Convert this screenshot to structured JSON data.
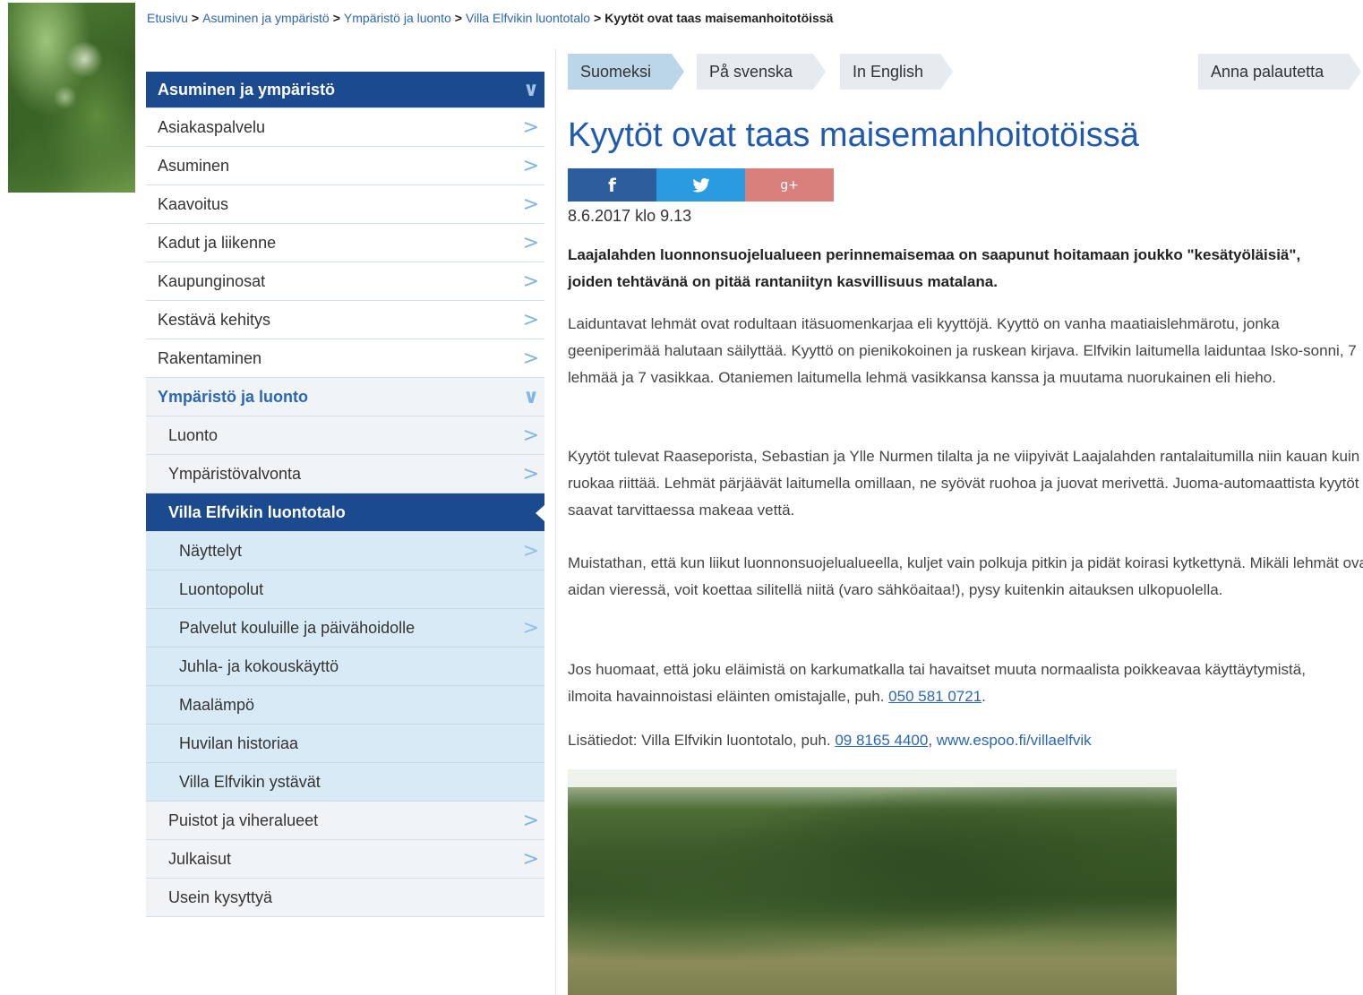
{
  "breadcrumb": {
    "items": [
      "Etusivu",
      "Asuminen ja ympäristö",
      "Ympäristö ja luonto",
      "Villa Elfvikin luontotalo"
    ],
    "separator": ">",
    "current": "Kyytöt ovat taas maisemanhoitotöissä"
  },
  "sidebar": {
    "head": "Asuminen ja ympäristö",
    "items": [
      "Asiakaspalvelu",
      "Asuminen",
      "Kaavoitus",
      "Kadut ja liikenne",
      "Kaupunginosat",
      "Kestävä kehitys",
      "Rakentaminen"
    ],
    "open_section": "Ympäristö ja luonto",
    "sub_items_before": [
      "Luonto",
      "Ympäristövalvonta"
    ],
    "active": "Villa Elfvikin luontotalo",
    "active_children": [
      "Näyttelyt",
      "Luontopolut",
      "Palvelut kouluille ja päivähoidolle",
      "Juhla- ja kokouskäyttö",
      "Maalämpö",
      "Huvilan historiaa",
      "Villa Elfvikin ystävät"
    ],
    "sub_items_after": [
      "Puistot ja viheralueet",
      "Julkaisut",
      "Usein kysyttyä"
    ]
  },
  "tabs": {
    "fi": "Suomeksi",
    "sv": "På svenska",
    "en": "In English",
    "feedback": "Anna palautetta"
  },
  "article": {
    "title": "Kyytöt ovat taas maisemanhoitotöissä",
    "share": {
      "facebook": "f",
      "twitter": "🐦",
      "gplus": "g+"
    },
    "date": "8.6.2017 klo 9.13",
    "lead": "Laajalahden luonnonsuojelualueen perinnemaisemaa on saapunut hoitamaan joukko \"kesätyöläisiä\", joiden tehtävänä on pitää rantaniityn kasvillisuus matalana.",
    "p1": "Laiduntavat lehmät ovat rodultaan itäsuomenkarjaa eli kyyttöjä. Kyyttö on vanha maatiaislehmärotu, jonka geeniperimää halutaan säilyttää. Kyyttö on pienikokoinen ja ruskean kirjava. Elfvikin laitumella laiduntaa Isko-sonni, 7 lehmää ja 7 vasikkaa. Otaniemen laitumella lehmä vasikkansa kanssa ja muutama nuorukainen eli hieho.",
    "p2": "Kyytöt tulevat Raaseporista, Sebastian ja Ylle Nurmen tilalta ja ne viipyivät Laajalahden rantalaitumilla niin kauan kuin ruokaa riittää. Lehmät pärjäävät laitumella omillaan, ne syövät ruohoa ja juovat merivettä. Juoma-automaattista kyytöt saavat tarvittaessa makeaa vettä.",
    "p3": "Muistathan, että kun liikut luonnonsuojelualueella, kuljet vain polkuja pitkin ja pidät koirasi kytkettynä. Mikäli lehmät ovat aidan vieressä, voit koettaa silitellä niitä (varo sähköaitaa!), pysy kuitenkin aitauksen ulkopuolella.",
    "p4_text": "Jos huomaat, että joku eläimistä on karkumatkalla tai havaitset muuta normaalista poikkeavaa käyttäytymistä, ilmoita havainnoistasi eläinten omistajalle, puh. ",
    "p4_phone": "050 581 0721",
    "p4_end": ".",
    "p5_label": "Lisätiedot:",
    "p5_text": " Villa Elfvikin luontotalo, puh. ",
    "p5_phone": "09 8165 4400",
    "p5_sep": ", ",
    "p5_url": "www.espoo.fi/villaelfvik"
  }
}
